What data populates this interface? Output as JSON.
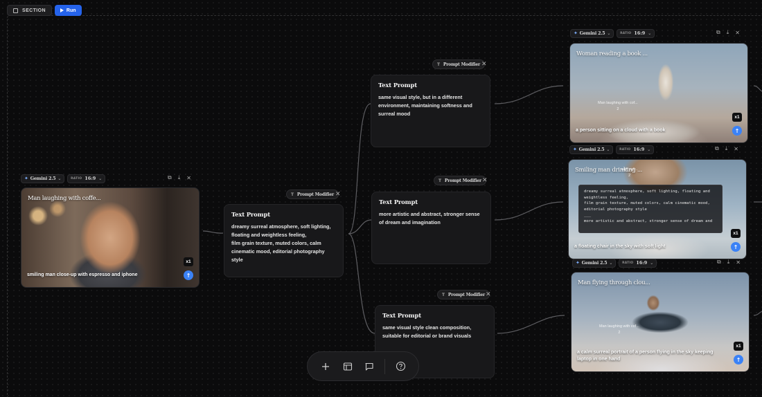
{
  "toolbar": {
    "section_label": "SECTION",
    "run_label": "Run"
  },
  "modifier_label": "Prompt Modifier",
  "text_prompts": [
    {
      "title": "Text Prompt",
      "body": "dreamy surreal atmosphere, soft lighting, floating and weightless feeling,\nfilm grain texture, muted colors, calm cinematic mood, editorial photography style"
    },
    {
      "title": "Text Prompt",
      "body": "same visual style, but in a different environment, maintaining softness and surreal mood"
    },
    {
      "title": "Text Prompt",
      "body": "more artistic and abstract, stronger sense of dream and imagination"
    },
    {
      "title": "Text Prompt",
      "body": "same visual style clean composition, suitable for editorial or brand visuals"
    }
  ],
  "image_nodes": [
    {
      "model": "Gemini 2.5",
      "ratio_label": "RATIO",
      "ratio": "16:9",
      "title": "Man laughing with coffe...",
      "caption": "smiling man close-up with espresso and iphone",
      "count": "x1"
    },
    {
      "model": "Gemini 2.5",
      "ratio_label": "RATIO",
      "ratio": "16:9",
      "title": "Woman reading a book ...",
      "caption": "a person sitting on a cloud with a book",
      "count": "x1",
      "ghost": "Man laughing with cof...\n2"
    },
    {
      "model": "Gemini 2.5",
      "ratio_label": "RATIO",
      "ratio": "16:9",
      "title": "Smiling man drinking ...",
      "caption": "a floating chair in the sky with soft light",
      "count": "x1",
      "ghost": "with cof...\n2",
      "overlay": "dreamy surreal atmosphere, soft lighting, floating and\nweightless feeling,\nfilm grain texture, muted colors, calm cinematic mood,\neditorial photography style\n___\nmore artistic and abstract, stronger sense of dream and"
    },
    {
      "model": "Gemini 2.5",
      "ratio_label": "RATIO",
      "ratio": "16:9",
      "title": "Man flying through clou...",
      "caption": "a calm surreal portrait of a person flying in the sky keeping laptop in one hand",
      "count": "x1",
      "ghost": "Man laughing with cof...\n2"
    }
  ],
  "icons": {
    "close": "✕",
    "chevron": "⌄",
    "sparkle": "✦",
    "copy": "⧉",
    "download": "⤓",
    "up_arrow": "↑",
    "t": "T",
    "add": "+",
    "help": "?"
  },
  "colors": {
    "run_button": "#2563eb",
    "upload_button": "#3b82f6",
    "background": "#0b0b0c"
  }
}
